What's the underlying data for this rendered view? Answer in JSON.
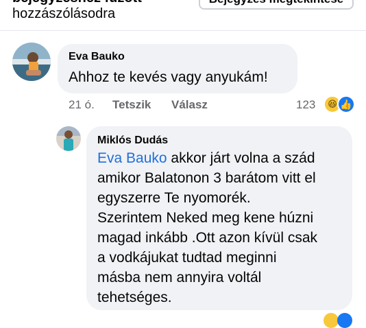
{
  "header": {
    "line1": "bejegyzéshez fűzött",
    "line2": "hozzászólásodra",
    "button_label": "Bejegyzés megtekintése"
  },
  "comments": [
    {
      "author": "Eva Bauko",
      "text": "Ahhoz te kevés vagy anyukám!",
      "time": "21 ó.",
      "like_label": "Tetszik",
      "reply_label": "Válasz",
      "reaction_count": "123",
      "reactions": [
        "haha-icon",
        "like-icon"
      ]
    },
    {
      "author": "Miklós Dudás",
      "mention": "Eva Bauko",
      "text_line1": " akkor járt volna a szád",
      "text_line2": "amikor Balatonon 3 barátom vitt el",
      "text_line3": "egyszerre Te nyomorék.",
      "text_line4": "Szerintem Neked meg kene húzni",
      "text_line5": "magad inkább .Ott azon kívül csak",
      "text_line6": "a vodkájukat tudtad meginni",
      "text_line7": "másba nem annyira voltál",
      "text_line8": "tehetséges."
    }
  ],
  "colors": {
    "bubble": "#f0f2f5",
    "mention": "#216fdb",
    "meta": "#65676b",
    "like_blue": "#1877f2",
    "haha_yellow": "#f7c83b"
  }
}
